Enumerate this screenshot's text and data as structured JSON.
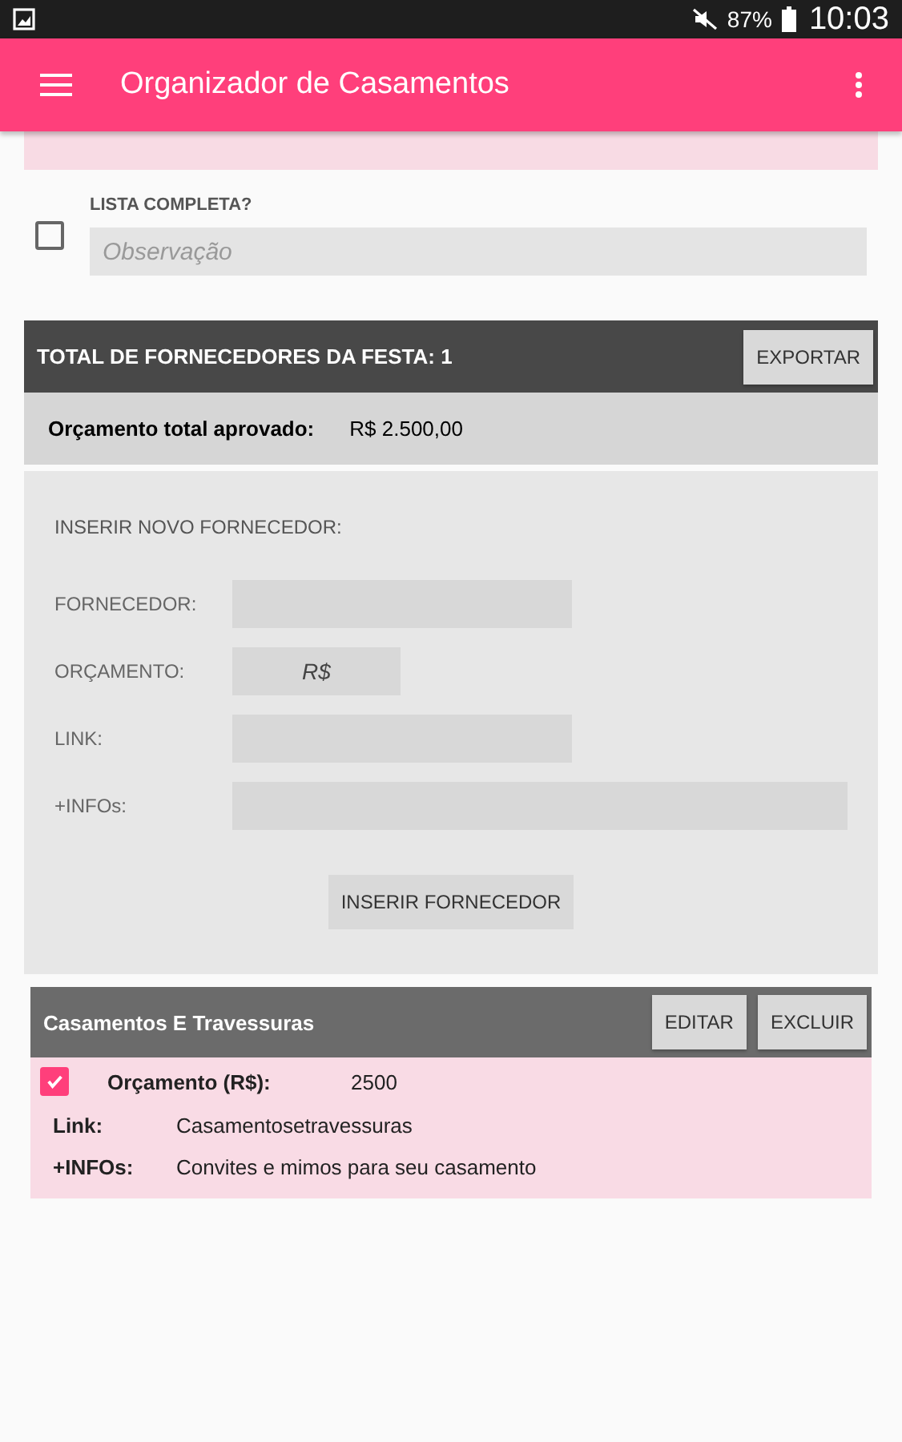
{
  "status_bar": {
    "battery": "87%",
    "time": "10:03"
  },
  "app_bar": {
    "title": "Organizador de Casamentos"
  },
  "complete_list": {
    "label": "LISTA COMPLETA?",
    "checked": false,
    "placeholder": "Observação"
  },
  "summary": {
    "title": "TOTAL DE FORNECEDORES DA FESTA: 1",
    "export_button": "EXPORTAR",
    "budget_label": "Orçamento total aprovado:",
    "budget_value": "R$ 2.500,00"
  },
  "new_supplier": {
    "title": "INSERIR NOVO FORNECEDOR:",
    "fields": [
      {
        "label": "FORNECEDOR:",
        "kind": "medium"
      },
      {
        "label": "ORÇAMENTO:",
        "kind": "short",
        "placeholder": "R$"
      },
      {
        "label": "LINK:",
        "kind": "medium"
      },
      {
        "label": "+INFOs:",
        "kind": "long"
      }
    ],
    "submit_button": "INSERIR FORNECEDOR"
  },
  "suppliers": [
    {
      "name": "Casamentos E Travessuras",
      "edit_button": "EDITAR",
      "delete_button": "EXCLUIR",
      "checked": true,
      "budget_label": "Orçamento (R$):",
      "budget": "2500",
      "link_label": "Link:",
      "link": "Casamentosetravessuras",
      "info_label": "+INFOs:",
      "info": "Convites e mimos para seu casamento"
    }
  ]
}
